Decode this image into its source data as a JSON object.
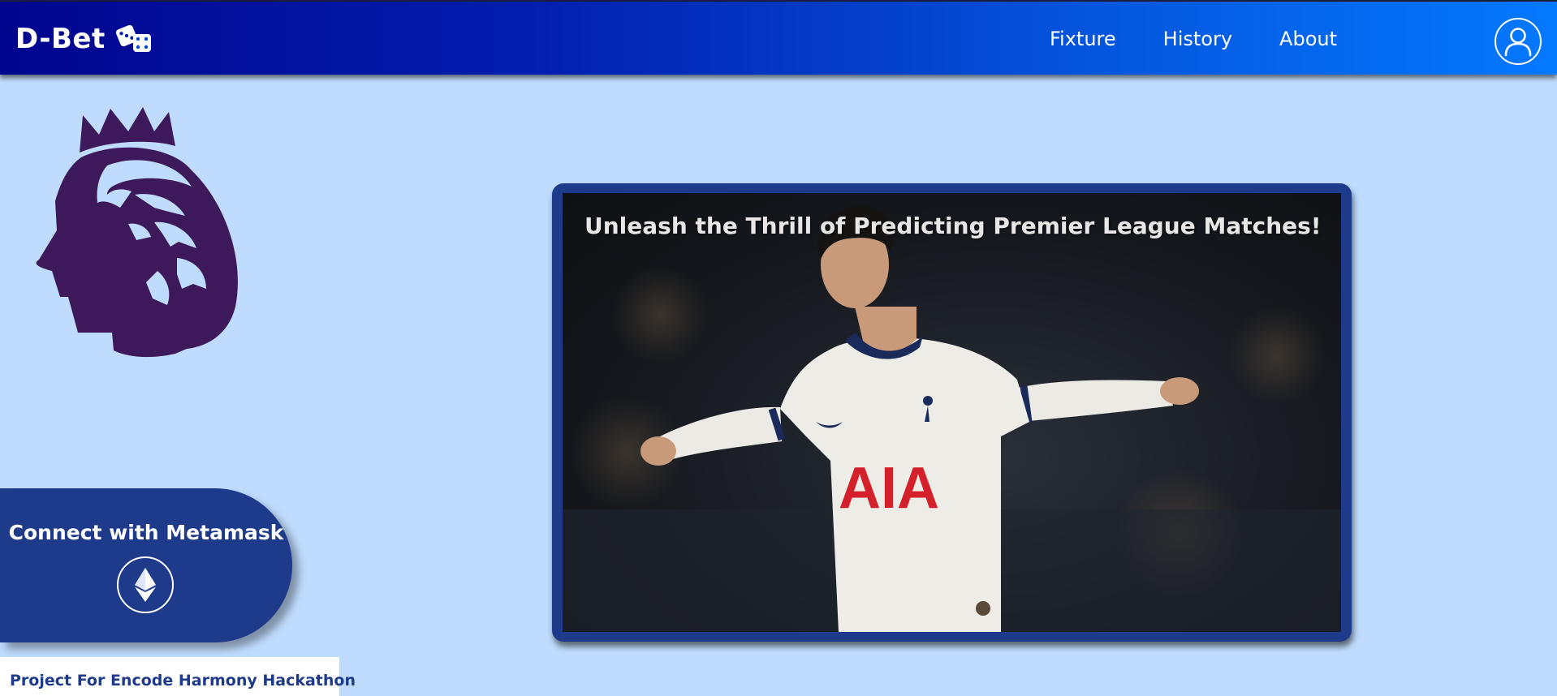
{
  "header": {
    "brand": "D-Bet",
    "brand_icon": "dice-icon",
    "nav": [
      {
        "label": "Fixture"
      },
      {
        "label": "History"
      },
      {
        "label": "About"
      }
    ],
    "profile_icon": "user-icon"
  },
  "logo": {
    "icon": "premier-league-lion-icon",
    "color": "#3d195b"
  },
  "metamask": {
    "label": "Connect with Metamask",
    "icon": "ethereum-icon"
  },
  "hero": {
    "title": "Unleash the Thrill of Predicting Premier League Matches!",
    "shirt_sponsor": "AIA"
  },
  "footer": {
    "note": "Project For Encode Harmony Hackathon"
  },
  "colors": {
    "page_background": "#bfdcfe",
    "navy": "#1e3a8a",
    "header_gradient_start": "#02058e",
    "header_gradient_end": "#0479ff",
    "sponsor_red": "#d3202a"
  }
}
